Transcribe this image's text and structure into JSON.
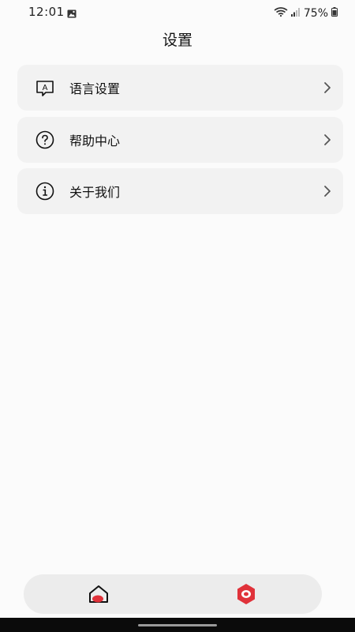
{
  "status_bar": {
    "time": "12:01",
    "battery": "75%",
    "icons": [
      "gallery-icon",
      "wifi-icon",
      "signal-icon",
      "battery-icon"
    ]
  },
  "header": {
    "title": "设置"
  },
  "menu": {
    "items": [
      {
        "label": "语言设置",
        "icon": "language-icon"
      },
      {
        "label": "帮助中心",
        "icon": "help-icon"
      },
      {
        "label": "关于我们",
        "icon": "info-icon"
      }
    ]
  },
  "bottom_nav": {
    "items": [
      {
        "icon": "home-icon"
      },
      {
        "icon": "record-icon"
      }
    ]
  },
  "colors": {
    "background": "#fbfbfb",
    "card": "#f2f2f2",
    "accent": "#e0323a"
  }
}
